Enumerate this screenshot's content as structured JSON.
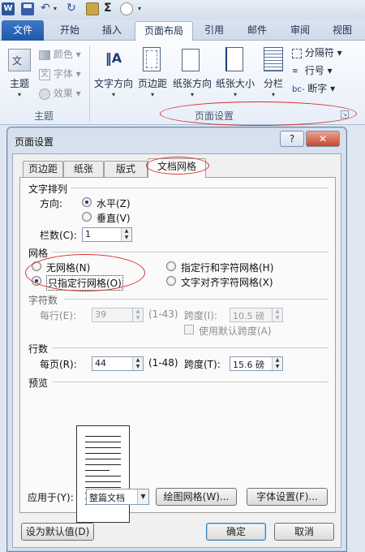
{
  "ribbon": {
    "tabs": [
      "文件",
      "开始",
      "插入",
      "页面布局",
      "引用",
      "邮件",
      "审阅",
      "视图"
    ],
    "theme_group": {
      "big_label": "主题",
      "colors": "颜色",
      "fonts": "字体",
      "effects": "效果",
      "group_label": "主题"
    },
    "page_setup_group": {
      "text_direction": "文字方向",
      "margins": "页边距",
      "orientation": "纸张方向",
      "size": "纸张大小",
      "columns": "分栏",
      "breaks": "分隔符",
      "line_numbers": "行号",
      "hyphenation": "断字",
      "group_label": "页面设置"
    }
  },
  "dialog": {
    "title": "页面设置",
    "help": "?",
    "close": "✕",
    "tabs": [
      "页边距",
      "纸张",
      "版式",
      "文档网格"
    ],
    "text_flow": {
      "section": "文字排列",
      "direction_label": "方向:",
      "horizontal": "水平(Z)",
      "vertical": "垂直(V)",
      "columns_label": "栏数(C):",
      "columns_value": "1"
    },
    "grid": {
      "section": "网格",
      "no_grid": "无网格(N)",
      "lines_only": "只指定行网格(O)",
      "chars_and_lines": "指定行和字符网格(H)",
      "snap_to_chars": "文字对齐字符网格(X)"
    },
    "characters": {
      "section": "字符数",
      "per_line_label": "每行(E):",
      "per_line_value": "39",
      "range": "(1-43)",
      "pitch_label": "跨度(I):",
      "pitch_value": "10.5 磅",
      "default_pitch": "使用默认跨度(A)"
    },
    "lines": {
      "section": "行数",
      "per_page_label": "每页(R):",
      "per_page_value": "44",
      "range": "(1-48)",
      "pitch_label": "跨度(T):",
      "pitch_value": "15.6 磅"
    },
    "preview": {
      "section": "预览"
    },
    "apply_to_label": "应用于(Y):",
    "apply_to_value": "整篇文档",
    "draw_grid": "绘图网格(W)...",
    "font_settings": "字体设置(F)...",
    "set_default": "设为默认值(D)",
    "ok": "确定",
    "cancel": "取消"
  },
  "colors": {
    "annotation": "#d8312a",
    "file_tab": "#2a63b2"
  },
  "selected": {
    "text_flow": "horizontal",
    "grid": "lines_only"
  }
}
